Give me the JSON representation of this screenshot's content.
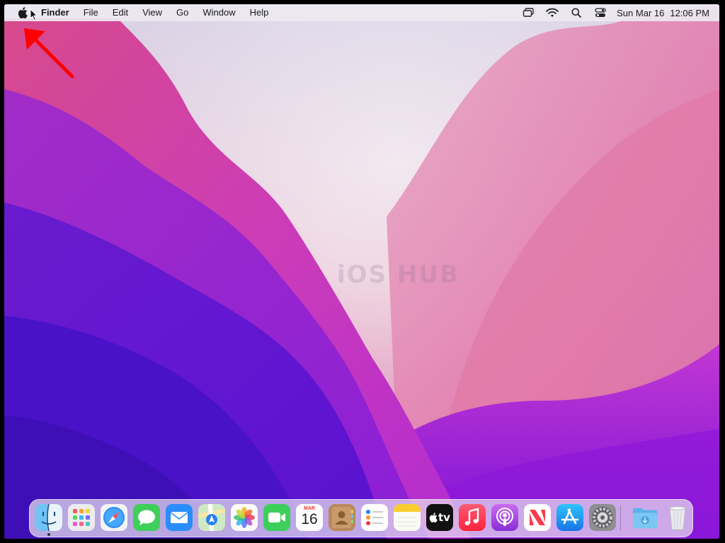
{
  "menubar": {
    "app_name": "Finder",
    "items": [
      "File",
      "Edit",
      "View",
      "Go",
      "Window",
      "Help"
    ],
    "status_icons": [
      "screen-mirroring-icon",
      "wifi-icon",
      "spotlight-search-icon",
      "control-center-icon"
    ],
    "date": "Sun Mar 16",
    "time": "12:06 PM"
  },
  "wallpaper": {
    "watermark": "iOS HUB"
  },
  "dock": {
    "apps": [
      {
        "name": "Finder",
        "icon": "finder-icon",
        "running": true
      },
      {
        "name": "Launchpad",
        "icon": "launchpad-icon"
      },
      {
        "name": "Safari",
        "icon": "safari-icon"
      },
      {
        "name": "Messages",
        "icon": "messages-icon"
      },
      {
        "name": "Mail",
        "icon": "mail-icon"
      },
      {
        "name": "Maps",
        "icon": "maps-icon"
      },
      {
        "name": "Photos",
        "icon": "photos-icon"
      },
      {
        "name": "FaceTime",
        "icon": "facetime-icon"
      },
      {
        "name": "Calendar",
        "icon": "calendar-icon",
        "month": "MAR",
        "day": "16"
      },
      {
        "name": "Contacts",
        "icon": "contacts-icon"
      },
      {
        "name": "Reminders",
        "icon": "reminders-icon"
      },
      {
        "name": "Notes",
        "icon": "notes-icon"
      },
      {
        "name": "TV",
        "icon": "apple-tv-icon",
        "label": "tv"
      },
      {
        "name": "Music",
        "icon": "music-icon"
      },
      {
        "name": "Podcasts",
        "icon": "podcasts-icon"
      },
      {
        "name": "News",
        "icon": "news-icon"
      },
      {
        "name": "App Store",
        "icon": "app-store-icon"
      },
      {
        "name": "System Preferences",
        "icon": "system-preferences-icon"
      }
    ],
    "stacks": [
      {
        "name": "Downloads",
        "icon": "downloads-folder-icon"
      },
      {
        "name": "Trash",
        "icon": "trash-icon"
      }
    ]
  },
  "colors": {
    "menubar_bg": "#ECE8F0",
    "annotation_arrow": "#FF0000",
    "wallpaper_purple": "#4A12C8",
    "wallpaper_magenta": "#C42BC0",
    "wallpaper_pink": "#E98FB0"
  }
}
